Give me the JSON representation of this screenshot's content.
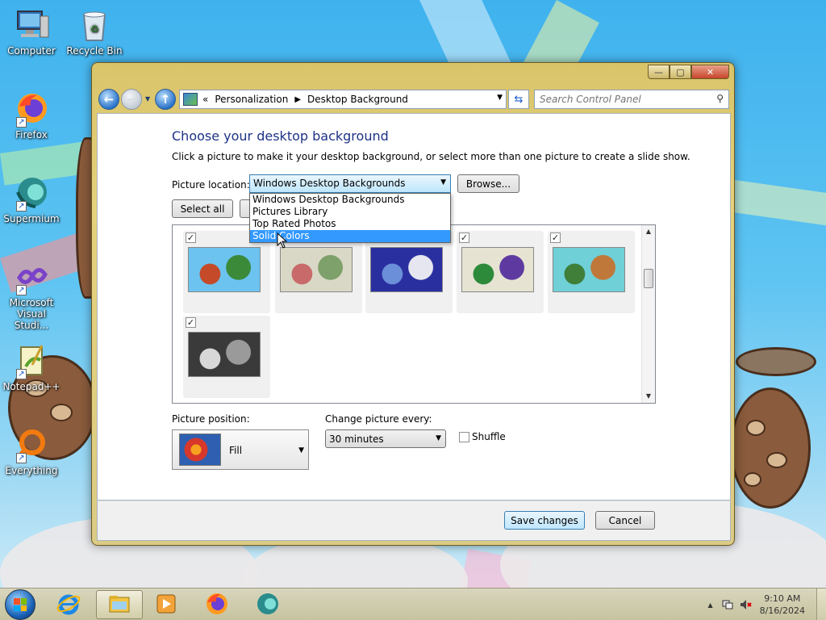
{
  "desktop": {
    "icons": [
      {
        "label": "Computer",
        "icon": "computer-icon"
      },
      {
        "label": "Recycle Bin",
        "icon": "recycle-bin-icon"
      },
      {
        "label": "Firefox",
        "icon": "firefox-icon"
      },
      {
        "label": "Supermium",
        "icon": "supermium-icon"
      },
      {
        "label": "Microsoft Visual Studi...",
        "icon": "visual-studio-icon"
      },
      {
        "label": "Notepad++",
        "icon": "notepad-plus-plus-icon"
      },
      {
        "label": "Everything",
        "icon": "everything-search-icon"
      }
    ]
  },
  "window": {
    "controls": {
      "minimize": "—",
      "maximize": "▢",
      "close": "✕"
    },
    "address": {
      "prefix": "«",
      "crumbs": [
        "Personalization",
        "Desktop Background"
      ],
      "separator": "▶"
    },
    "search": {
      "placeholder": "Search Control Panel"
    },
    "heading": "Choose your desktop background",
    "subtext": "Click a picture to make it your desktop background, or select more than one picture to create a slide show.",
    "picture_location": {
      "label": "Picture location:",
      "value": "Windows Desktop Backgrounds",
      "options": [
        "Windows Desktop Backgrounds",
        "Pictures Library",
        "Top Rated Photos",
        "Solid Colors"
      ],
      "highlighted": "Solid Colors"
    },
    "browse_label": "Browse...",
    "select_all_label": "Select all",
    "thumbnails": [
      {
        "checked": true,
        "palette": [
          "#6cc3f0",
          "#3a8a3a",
          "#c44a2a"
        ]
      },
      {
        "checked": false,
        "palette": [
          "#d9d8c6",
          "#7ea06a",
          "#c86a6a"
        ]
      },
      {
        "checked": false,
        "palette": [
          "#2a2fa0",
          "#e6e6f0",
          "#6b8fd8"
        ]
      },
      {
        "checked": true,
        "palette": [
          "#e6e3d2",
          "#5e3aa0",
          "#2d8a3a"
        ]
      },
      {
        "checked": true,
        "palette": [
          "#6fd0d8",
          "#c0783a",
          "#3f7f3a"
        ]
      },
      {
        "checked": true,
        "palette": [
          "#3a3a3a",
          "#9a9a9a",
          "#d8d8d8"
        ]
      }
    ],
    "picture_position": {
      "label": "Picture position:",
      "value": "Fill"
    },
    "change_picture": {
      "label": "Change picture every:",
      "value": "30 minutes"
    },
    "shuffle": {
      "label": "Shuffle",
      "checked": false
    },
    "save_label": "Save changes",
    "cancel_label": "Cancel"
  },
  "taskbar": {
    "items": [
      {
        "icon": "internet-explorer-icon",
        "active": false
      },
      {
        "icon": "file-explorer-icon",
        "active": true
      },
      {
        "icon": "media-player-icon",
        "active": false
      },
      {
        "icon": "firefox-icon",
        "active": false
      },
      {
        "icon": "supermium-icon",
        "active": false
      }
    ],
    "clock": {
      "time": "9:10 AM",
      "date": "8/16/2024"
    },
    "tray": {
      "show_hidden": "▲"
    }
  },
  "colors": {
    "accent": "#3399ff",
    "heading": "#1e3287",
    "window_frame": "#e6d17c"
  }
}
